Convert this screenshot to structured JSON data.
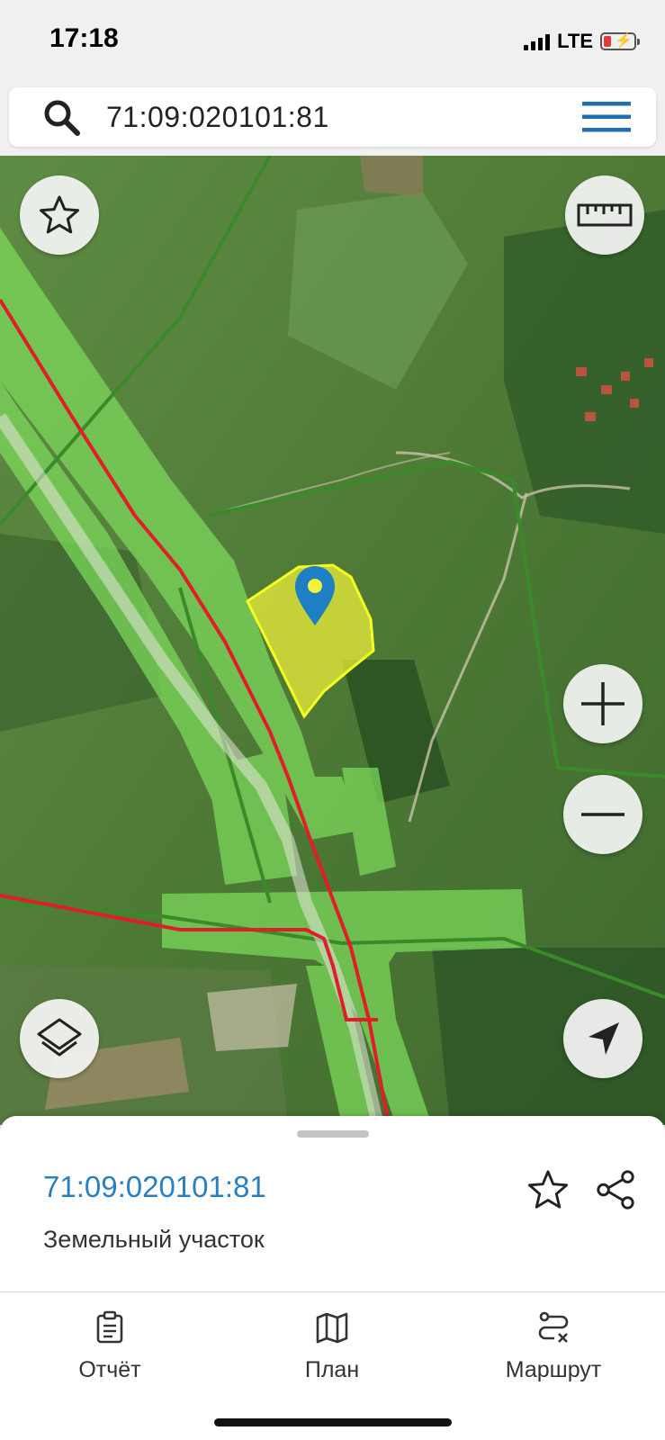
{
  "status_bar": {
    "time": "17:18",
    "network": "LTE",
    "battery_color": "#e53935"
  },
  "search": {
    "query": "71:09:020101:81",
    "icon": "search-icon",
    "menu_icon": "hamburger-menu-icon",
    "menu_color": "#1f6fb2"
  },
  "map": {
    "parcel_color": "#f2f23a",
    "pin_color": "#1e7fc4",
    "buttons": {
      "favorite": "star-icon",
      "ruler": "ruler-icon",
      "zoom_in": "plus-icon",
      "zoom_out": "minus-icon",
      "layers": "layers-icon",
      "locate": "location-arrow-icon"
    }
  },
  "sheet": {
    "title": "71:09:020101:81",
    "subtitle": "Земельный участок",
    "title_color": "#2a7fc0"
  },
  "tabs": [
    {
      "label": "Отчёт",
      "icon": "clipboard-icon"
    },
    {
      "label": "План",
      "icon": "map-icon"
    },
    {
      "label": "Маршрут",
      "icon": "route-icon"
    }
  ]
}
